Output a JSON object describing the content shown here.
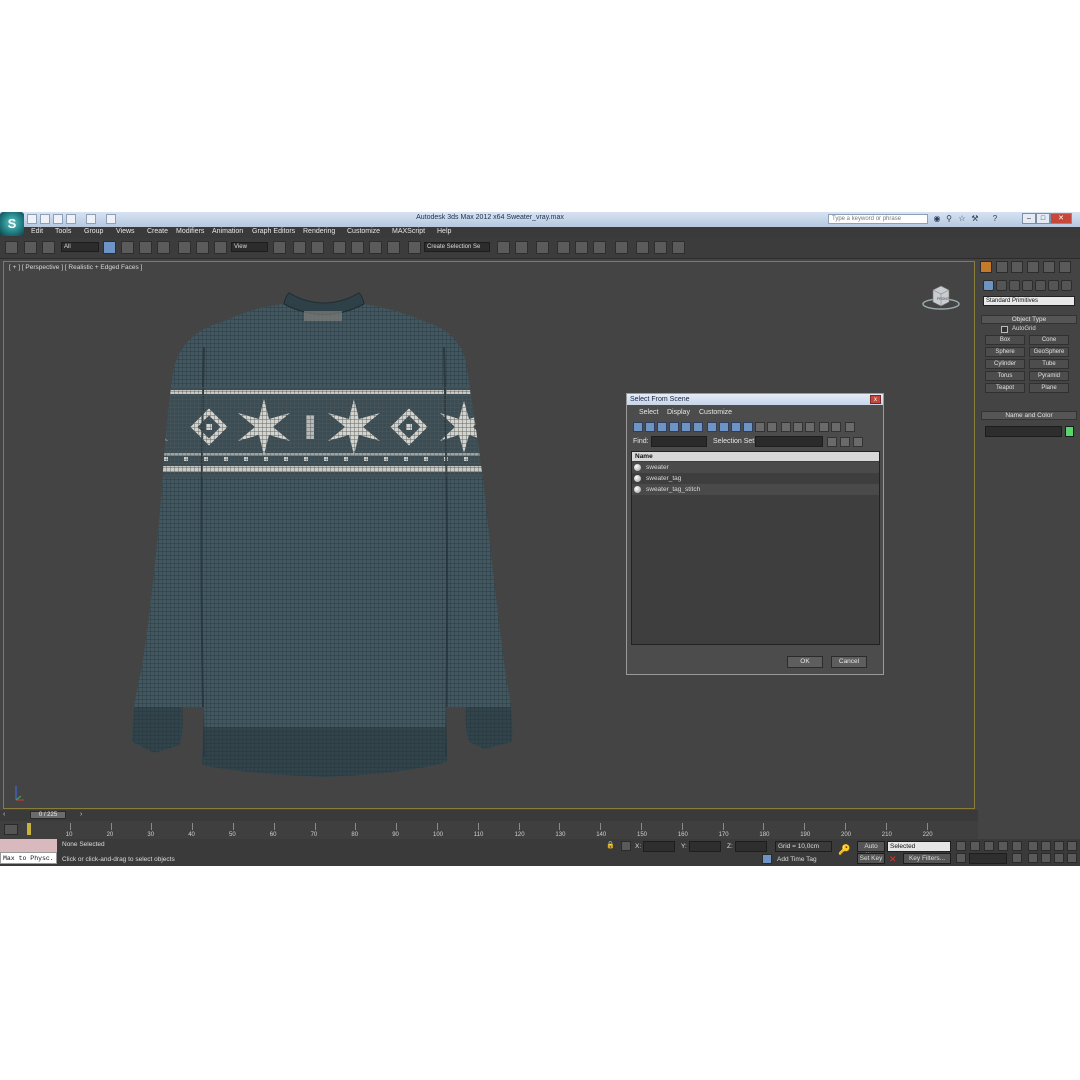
{
  "window": {
    "title": "Autodesk 3ds Max  2012 x64      Sweater_vray.max",
    "search_placeholder": "Type a keyword or phrase",
    "logo_letter": "S"
  },
  "menu": [
    "Edit",
    "Tools",
    "Group",
    "Views",
    "Create",
    "Modifiers",
    "Animation",
    "Graph Editors",
    "Rendering",
    "Customize",
    "MAXScript",
    "Help"
  ],
  "toolbar": {
    "selection_filter": "All",
    "reference_coord": "View",
    "named_selection": "Create Selection Se"
  },
  "viewport": {
    "label": "[ + ] [ Perspective ] [ Realistic + Edged Faces ]",
    "viewcube_face": "FRONT"
  },
  "dialog": {
    "title": "Select From Scene",
    "close_label": "x",
    "menus": [
      "Select",
      "Display",
      "Customize"
    ],
    "find_label": "Find:",
    "selection_set_label": "Selection Set:",
    "column_name": "Name",
    "items": [
      "sweater",
      "sweater_tag",
      "sweater_tag_stitch"
    ],
    "ok_label": "OK",
    "cancel_label": "Cancel"
  },
  "command_panel": {
    "category": "Standard Primitives",
    "object_type_title": "Object Type",
    "autogrid_label": "AutoGrid",
    "primitives": [
      "Box",
      "Cone",
      "Sphere",
      "GeoSphere",
      "Cylinder",
      "Tube",
      "Torus",
      "Pyramid",
      "Teapot",
      "Plane"
    ],
    "name_color_title": "Name and Color",
    "object_color": "#57d66b"
  },
  "timeline": {
    "frame_display": "0 / 225",
    "tick_labels": [
      "10",
      "20",
      "30",
      "40",
      "50",
      "60",
      "70",
      "80",
      "90",
      "100",
      "110",
      "120",
      "130",
      "140",
      "150",
      "160",
      "170",
      "180",
      "190",
      "200",
      "210",
      "220"
    ]
  },
  "status": {
    "maxscript_label": "Max to Physc.",
    "selection_status": "None Selected",
    "prompt": "Click or click-and-drag to select objects",
    "x_label": "X:",
    "y_label": "Y:",
    "z_label": "Z:",
    "grid": "Grid = 10,0cm",
    "add_time_tag": "Add Time Tag",
    "auto_key": "Auto Key",
    "set_key": "Set Key",
    "key_mode": "Selected",
    "key_filters": "Key Filters..."
  },
  "colors": {
    "sweater_body": "#3f525a",
    "pattern": "#c9c9c4",
    "selection_highlight": "#6e93c5"
  }
}
